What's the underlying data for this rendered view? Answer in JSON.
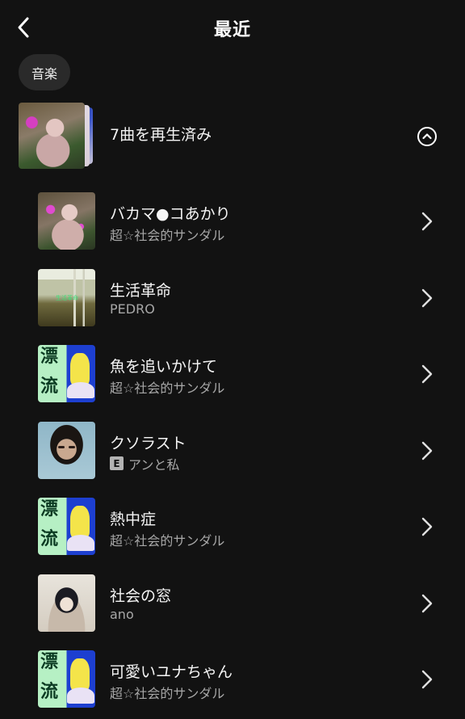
{
  "header": {
    "title": "最近"
  },
  "filter": {
    "chip_label": "音楽"
  },
  "group": {
    "title": "7曲を再生済み"
  },
  "songs": [
    {
      "title": "バカマ●コあかり",
      "artist": "超☆社会的サンダル",
      "explicit": false,
      "art": "akari"
    },
    {
      "title": "生活革命",
      "artist": "PEDRO",
      "explicit": false,
      "art": "pedro",
      "art_text": "生活革命"
    },
    {
      "title": "魚を追いかけて",
      "artist": "超☆社会的サンダル",
      "explicit": false,
      "art": "sandal",
      "art_text": [
        "漂",
        "流"
      ]
    },
    {
      "title": "クソラスト",
      "artist": "アンと私",
      "explicit": true,
      "explicit_label": "E",
      "art": "ann"
    },
    {
      "title": "熱中症",
      "artist": "超☆社会的サンダル",
      "explicit": false,
      "art": "sandal",
      "art_text": [
        "漂",
        "流"
      ]
    },
    {
      "title": "社会の窓",
      "artist": "ano",
      "explicit": false,
      "art": "ano"
    },
    {
      "title": "可愛いユナちゃん",
      "artist": "超☆社会的サンダル",
      "explicit": false,
      "art": "sandal",
      "art_text": [
        "漂",
        "流"
      ]
    }
  ],
  "colors": {
    "background": "#121212",
    "secondary_text": "#a7a7a7",
    "chip_bg": "#2a2a2a"
  },
  "icons": {
    "back": "chevron-left-icon",
    "collapse": "chevron-up-circle-icon",
    "row": "chevron-right-icon"
  }
}
